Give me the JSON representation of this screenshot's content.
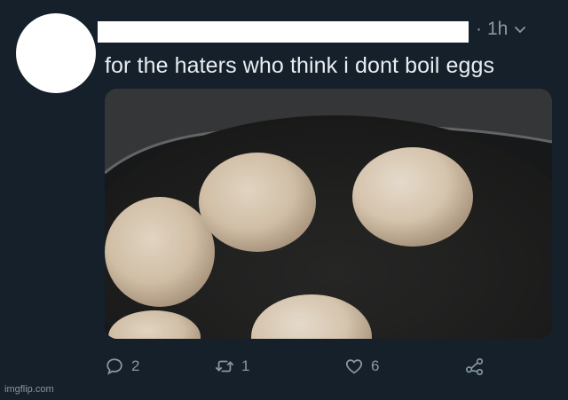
{
  "tweet": {
    "time": "1h",
    "separator": "·",
    "text": "for the haters who think i dont boil eggs",
    "caret_icon": "chevron-down-icon"
  },
  "actions": {
    "reply": {
      "icon": "reply-icon",
      "count": "2"
    },
    "retweet": {
      "icon": "retweet-icon",
      "count": "1"
    },
    "like": {
      "icon": "heart-icon",
      "count": "6"
    },
    "share": {
      "icon": "share-icon"
    }
  },
  "watermark": "imgflip.com",
  "colors": {
    "background": "#15202b",
    "secondary_text": "#8899a6",
    "primary_text": "#e8edf1"
  }
}
